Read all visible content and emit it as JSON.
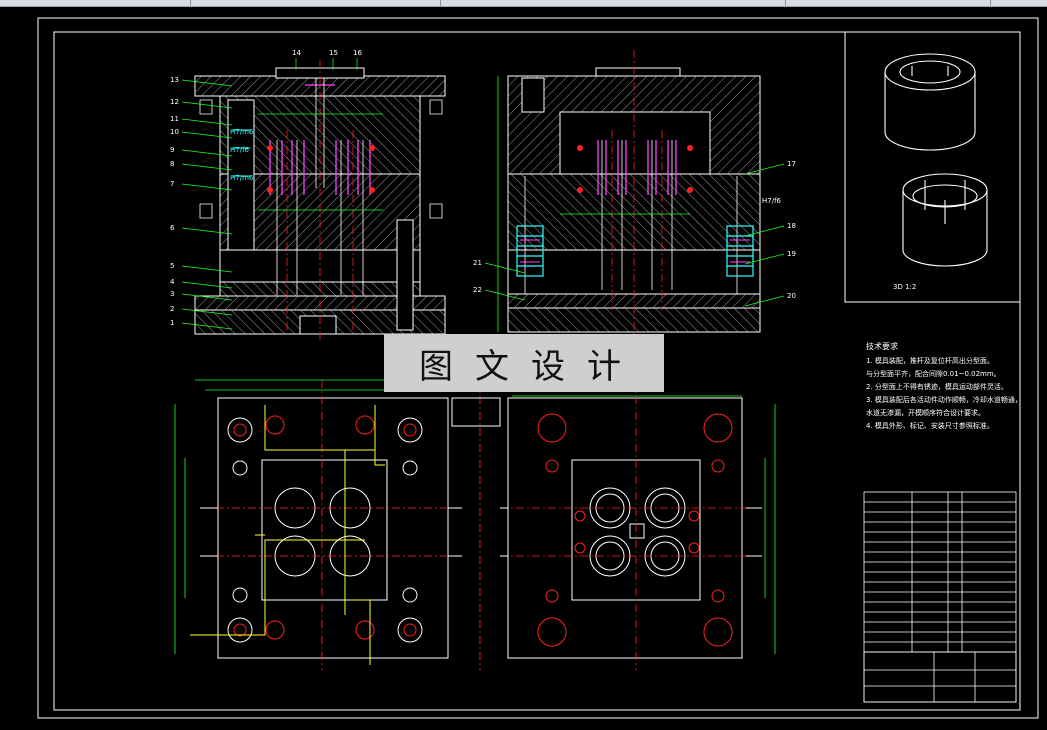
{
  "toolbar": {
    "present": true
  },
  "watermark": {
    "text": "图文设计"
  },
  "notes": {
    "title": "技术要求",
    "lines": [
      "1. 模具装配，推杆及复位杆高出分型面。",
      "与分型面平齐，配合间隙0.01~0.02mm。",
      "2. 分型面上不得有锈迹，模具运动部件灵活。",
      "3. 模具装配后各活动件动作顺畅，冷却水道畅通，",
      "水道无渗漏，开模顺序符合设计要求。",
      "4. 模具外形、标记、安装尺寸参照标准。"
    ]
  },
  "view3d": {
    "scale_label": "3D 1:2"
  },
  "callouts_left": [
    "13",
    "12",
    "11",
    "10",
    "9",
    "8",
    "7",
    "6",
    "5",
    "4",
    "3",
    "2",
    "1"
  ],
  "callouts_top": [
    "14",
    "15",
    "16"
  ],
  "callouts_right": [
    "17",
    "18",
    "19",
    "20"
  ],
  "callouts_mid": [
    "21",
    "22"
  ],
  "fit_labels": [
    "H7/m6",
    "H7/f6",
    "H7/m6",
    "H7/f6"
  ],
  "colors": {
    "line": "#ffffff",
    "hatch": "#c8c8c8",
    "center": "#ff2020",
    "dim": "#20ff20",
    "yellow": "#ffff30",
    "magenta": "#ff20ff",
    "cyan": "#30ffff"
  }
}
